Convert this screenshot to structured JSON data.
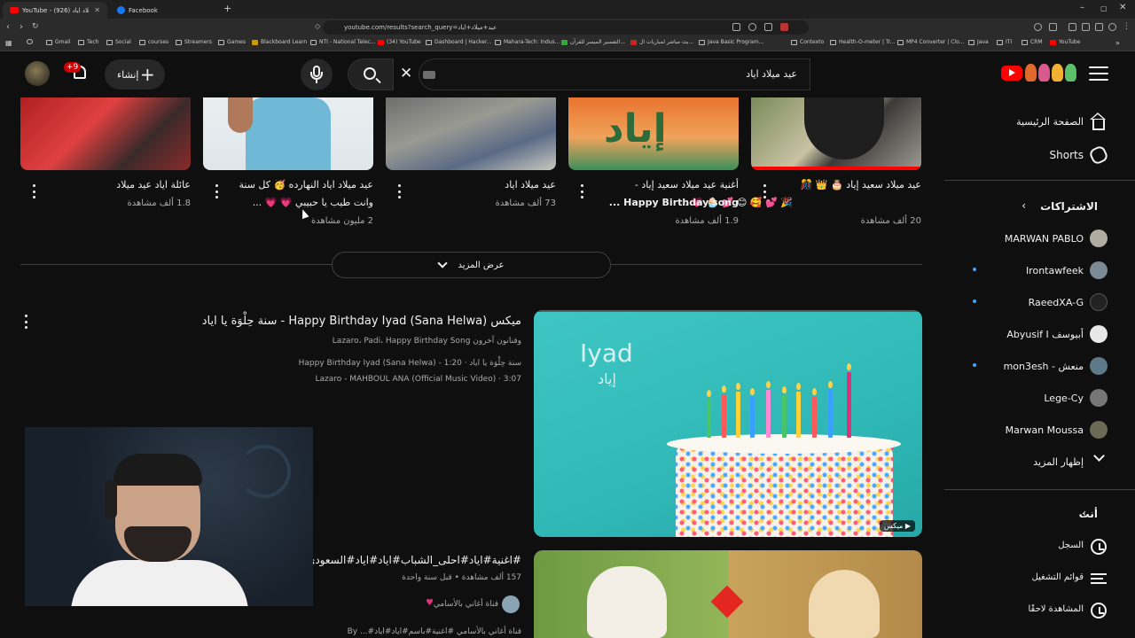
{
  "browser": {
    "tabs": [
      {
        "label": "YouTube - (926) عيد ميلاد اياد",
        "active": true
      },
      {
        "label": "Facebook",
        "active": false
      }
    ],
    "url": "youtube.com/results?search_query=عيد+ميلاد+اياد",
    "bookmarks": [
      "Gmail",
      "Tech",
      "Social",
      "courses",
      "Streamers",
      "Games",
      "Blackboard Learn",
      "NTI - National Telec...",
      "(34) YouTube",
      "Dashboard | Hacker...",
      "Mahara-Tech: Indus...",
      "التفسير الميسر للقرآن...",
      "بث مباشر لمباريات ال...",
      "Java Basic Program...",
      "Contexto",
      "Health-O-meter | Tr...",
      "MP4 Converter | Clo...",
      "Java",
      "ITI",
      "CRM",
      "YouTube"
    ]
  },
  "header": {
    "search_value": "عيد ميلاد اياد",
    "create_label": "إنشاء",
    "notification_badge": "+9"
  },
  "sidebar": {
    "main": [
      {
        "label": "الصفحة الرئيسية",
        "icon": "home-icon"
      },
      {
        "label": "Shorts",
        "icon": "shorts-icon"
      }
    ],
    "subscriptions_heading": "الاشتراكات",
    "subscriptions": [
      {
        "label": "MARWAN PABLO",
        "new": false
      },
      {
        "label": "Irontawfeek",
        "new": true
      },
      {
        "label": "RaeedXA-G",
        "new": true
      },
      {
        "label": "Abyusif I أبيوسف",
        "new": false
      },
      {
        "label": "mon3esh - منعش",
        "new": true
      },
      {
        "label": "Lege-Cy",
        "new": false
      },
      {
        "label": "Marwan Moussa",
        "new": false
      }
    ],
    "show_more": "إظهار المزيد",
    "you_heading": "أنت",
    "you_items": [
      {
        "label": "السجل",
        "icon": "history-icon"
      },
      {
        "label": "قوائم التشغيل",
        "icon": "playlist-icon"
      },
      {
        "label": "المشاهدة لاحقًا",
        "icon": "watch-later-icon"
      }
    ]
  },
  "shelf": {
    "videos": [
      {
        "title1": "عيد ميلاد سعيد إياد 🎂 👑 🎊",
        "title2": "🎉 💕 🥰 😊 💕 🧁 💗 ...",
        "views": "20 ألف مشاهدة"
      },
      {
        "title1": "أغنية عيد ميلاد سعيد إياد -",
        "title2": "Happy Birthday song ...",
        "views": "1.9 ألف مشاهدة"
      },
      {
        "title1": "عيد ميلاد اياد",
        "title2": "",
        "views": "73 ألف مشاهدة"
      },
      {
        "title1": "عيد ميلاد اياد النهارده 🥳 كل سنة",
        "title2": "وانت طيب يا حبيبي 💗 💗 ...",
        "views": "2 مليون مشاهدة"
      },
      {
        "title1": "عائلة اياد عيد ميلاد",
        "title2": "",
        "views": "1.8 ألف مشاهدة"
      }
    ],
    "show_more": "عرض المزيد"
  },
  "results": [
    {
      "title": "ميكس Happy Birthday Iyad (Sana Helwa) - سنة حِلْوَة يا اياد",
      "line1": "وفنانون آخرون Lazaro، Padi، Happy Birthday Song",
      "line2": "سنة حِلْوَة يا اياد · Happy Birthday Iyad (Sana Helwa) - 1:20",
      "line3": "Lazaro - MAHBOUL ANA (Official Music Video) · 3:07",
      "thumb_text_en": "Iyad",
      "thumb_text_ar": "إياد",
      "badge": "ميكس"
    },
    {
      "title": "#اغنية#اياد#احلى_الشباب#اياد#اياد#السعودي",
      "line1": "157 ألف مشاهدة • قبل سنة واحدة",
      "channel": "قناة أغاني بالأسامي",
      "line3": "قناة أغاني بالأسامي #اغنية#باسم#اياد#اياد#... By"
    }
  ],
  "shelf_thumb_text": "إياد",
  "colors": {
    "accent": "#ff0000",
    "background": "#0f0f0f",
    "text": "#f1f1f1",
    "secondary": "#aaaaaa",
    "new_dot": "#3ea6ff"
  }
}
